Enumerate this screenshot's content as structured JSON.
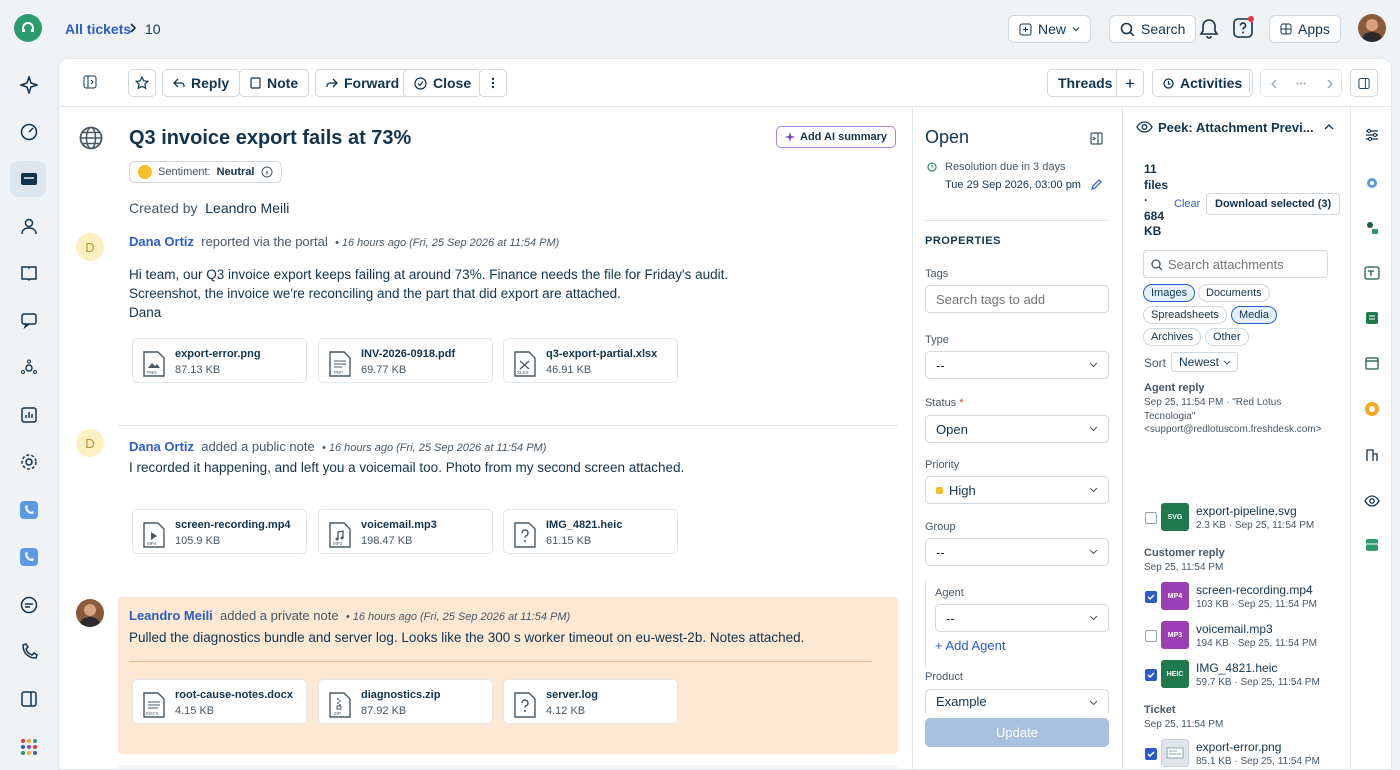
{
  "topbar": {
    "breadcrumb_link": "All tickets",
    "ticket_number": "10",
    "new_label": "New",
    "search_label": "Search",
    "apps_label": "Apps"
  },
  "toolbar": {
    "reply": "Reply",
    "note": "Note",
    "forward": "Forward",
    "close": "Close",
    "threads": "Threads",
    "activities": "Activities"
  },
  "ticket": {
    "title": "Q3 invoice export fails at 73%",
    "add_ai_summary": "Add AI summary",
    "sentiment_label": "Sentiment:",
    "sentiment_value": "Neutral",
    "created_by_label": "Created by",
    "created_by_name": "Leandro Meili"
  },
  "messages": [
    {
      "avatar": "D",
      "author": "Dana Ortiz",
      "action": "reported via the portal",
      "time": "• 16 hours ago (Fri, 25 Sep 2026 at 11:54 PM)",
      "lines": [
        "Hi team, our Q3 invoice export keeps failing at around 73%. Finance needs the file for Friday's audit.",
        "Screenshot, the invoice we're reconciling and the part that did export are attached.",
        "Dana"
      ],
      "attachments": [
        {
          "name": "export-error.png",
          "size": "87.13 KB",
          "ext": "PNG"
        },
        {
          "name": "INV-2026-0918.pdf",
          "size": "69.77 KB",
          "ext": "PDF"
        },
        {
          "name": "q3-export-partial.xlsx",
          "size": "46.91 KB",
          "ext": "XLSX"
        }
      ]
    },
    {
      "avatar": "D",
      "author": "Dana Ortiz",
      "action": "added a public note",
      "time": "• 16 hours ago (Fri, 25 Sep 2026 at 11:54 PM)",
      "lines": [
        "I recorded it happening, and left you a voicemail too. Photo from my second screen attached."
      ],
      "attachments": [
        {
          "name": "screen-recording.mp4",
          "size": "105.9 KB",
          "ext": "MP4"
        },
        {
          "name": "voicemail.mp3",
          "size": "198.47 KB",
          "ext": "MP3"
        },
        {
          "name": "IMG_4821.heic",
          "size": "61.15 KB",
          "ext": "?"
        }
      ]
    },
    {
      "avatar": "",
      "author": "Leandro Meili",
      "action": "added a private note",
      "time": "• 16 hours ago (Fri, 25 Sep 2026 at 11:54 PM)",
      "lines": [
        "Pulled the diagnostics bundle and server log. Looks like the 300 s worker timeout on eu-west-2b. Notes attached."
      ],
      "attachments": [
        {
          "name": "root-cause-notes.docx",
          "size": "4.15 KB",
          "ext": "DOCX"
        },
        {
          "name": "diagnostics.zip",
          "size": "87.92 KB",
          "ext": "ZIP"
        },
        {
          "name": "server.log",
          "size": "4.12 KB",
          "ext": "?"
        }
      ]
    }
  ],
  "properties": {
    "status_title": "Open",
    "resolution_label": "Resolution due in 3 days",
    "resolution_date": "Tue 29 Sep 2026, 03:00 pm",
    "section": "PROPERTIES",
    "tags_label": "Tags",
    "tags_placeholder": "Search tags to add",
    "type_label": "Type",
    "type_value": "--",
    "status_label": "Status",
    "status_required": "*",
    "status_value": "Open",
    "priority_label": "Priority",
    "priority_value": "High",
    "priority_color": "#f5c02c",
    "group_label": "Group",
    "group_value": "--",
    "agent_label": "Agent",
    "agent_value": "--",
    "add_agent": "+ Add Agent",
    "product_label": "Product",
    "product_value": "Example",
    "update_label": "Update"
  },
  "peek": {
    "title": "Peek: Attachment Previ...",
    "count_line1": "11",
    "count_line2": "files",
    "count_line3": "·",
    "count_line4": "684",
    "count_line5": "KB",
    "clear": "Clear",
    "download": "Download selected (3)",
    "search_placeholder": "Search attachments",
    "chips": [
      "Images",
      "Documents",
      "Spreadsheets",
      "Media",
      "Archives",
      "Other"
    ],
    "sort_label": "Sort",
    "sort_value": "Newest",
    "agent_reply_title": "Agent reply",
    "agent_reply_meta1": "Sep 25, 11:54 PM · \"Red Lotus",
    "agent_reply_meta2": "Tecnologia\"",
    "agent_reply_meta3": "<support@redlotuscom.freshdesk.com>",
    "customer_reply_title": "Customer reply",
    "customer_reply_meta": "Sep 25, 11:54 PM",
    "ticket_title": "Ticket",
    "ticket_meta": "Sep 25, 11:54 PM",
    "files": [
      {
        "name": "export-pipeline.svg",
        "meta": "2.3 KB · Sep 25, 11:54 PM",
        "tag": "SVG",
        "color": "#1e7a4c"
      },
      {
        "name": "screen-recording.mp4",
        "meta": "103 KB · Sep 25, 11:54 PM",
        "tag": "MP4",
        "color": "#9b3fb5"
      },
      {
        "name": "voicemail.mp3",
        "meta": "194 KB · Sep 25, 11:54 PM",
        "tag": "MP3",
        "color": "#9b3fb5"
      },
      {
        "name": "IMG_4821.heic",
        "meta": "59.7 KB · Sep 25, 11:54 PM",
        "tag": "HEIC",
        "color": "#1e7a4c"
      },
      {
        "name": "export-error.png",
        "meta": "85.1 KB · Sep 25, 11:54 PM",
        "tag": "",
        "color": "#c8d1da"
      }
    ]
  }
}
